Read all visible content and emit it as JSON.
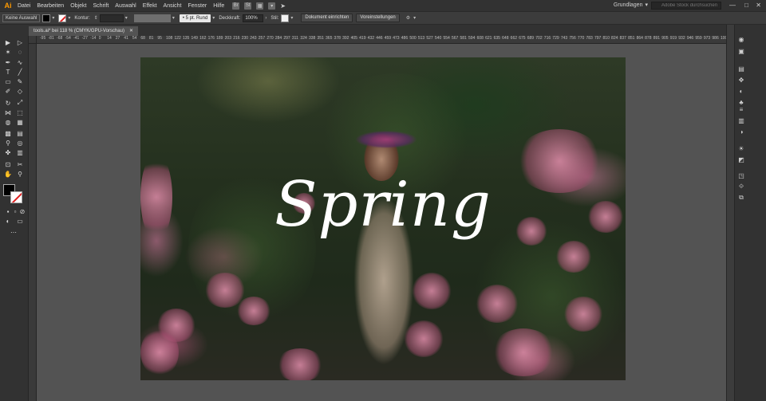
{
  "app": {
    "logo": "Ai"
  },
  "menu": [
    "Datei",
    "Bearbeiten",
    "Objekt",
    "Schrift",
    "Auswahl",
    "Effekt",
    "Ansicht",
    "Fenster",
    "Hilfe"
  ],
  "menu_icons": [
    "Br",
    "St"
  ],
  "workspace": "Grundlagen",
  "search": {
    "placeholder": "Adobe Stock durchsuchen"
  },
  "window_controls": {
    "minimize": "—",
    "maximize": "□",
    "close": "✕"
  },
  "control": {
    "selection": "Keine Auswahl",
    "stroke_label": "Kontur:",
    "stroke_preset": "5 pt. Rund",
    "opacity_label": "Deckkraft:",
    "opacity_value": "100%",
    "style_label": "Stil:",
    "doc_setup_button": "Dokument einrichten",
    "preferences_button": "Voreinstellungen"
  },
  "document_tab": {
    "title": "tools.ai* bei 118 % (CMYK/GPU-Vorschau)",
    "close": "✕"
  },
  "ruler_ticks": [
    "-95",
    "-81",
    "-68",
    "-54",
    "-41",
    "-27",
    "-14",
    "0",
    "14",
    "27",
    "41",
    "54",
    "68",
    "81",
    "95",
    "108",
    "122",
    "135",
    "149",
    "162",
    "176",
    "189",
    "203",
    "216",
    "230",
    "243",
    "257",
    "270",
    "284",
    "297",
    "311",
    "324",
    "338",
    "351",
    "365",
    "378",
    "392",
    "405",
    "419",
    "432",
    "446",
    "459",
    "473",
    "486",
    "500",
    "513",
    "527",
    "540",
    "554",
    "567",
    "581",
    "594",
    "608",
    "621",
    "635",
    "648",
    "662",
    "675",
    "689",
    "702",
    "716",
    "729",
    "743",
    "756",
    "770",
    "783",
    "797",
    "810",
    "824",
    "837",
    "851",
    "864",
    "878",
    "891",
    "905",
    "919",
    "932",
    "946",
    "959",
    "973",
    "986",
    "1000",
    "1009"
  ],
  "artwork": {
    "title_text": "Spring"
  },
  "icons": {
    "select": "▶",
    "direct_select": "▷",
    "magic_wand": "✶",
    "lasso": "◌",
    "pen": "✒",
    "curvature": "∿",
    "type": "T",
    "line": "╱",
    "rect": "▭",
    "brush": "✎",
    "shaper": "✐",
    "eraser": "◇",
    "rotate": "↻",
    "scale": "⤢",
    "width": "⋈",
    "free_transform": "⬚",
    "shape_builder": "◍",
    "perspective": "▦",
    "mesh": "▩",
    "gradient": "▤",
    "eyedropper": "⚲",
    "blend": "◎",
    "symbol": "✤",
    "graph": "▥",
    "artboard": "⊡",
    "slice": "✂",
    "hand": "✋",
    "zoom": "⚲",
    "draw_mode": "◐",
    "screen_mode": "▭",
    "dock": [
      "◉",
      "▣",
      "▤",
      "✥",
      "◐",
      "♣",
      "≡",
      "▥",
      "◑",
      "☀",
      "◩",
      "◳",
      "⟐",
      "⧉",
      "❏"
    ]
  }
}
